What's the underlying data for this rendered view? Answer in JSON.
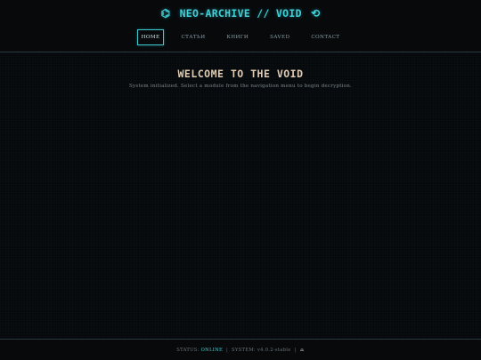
{
  "header": {
    "left_icon": "hexagon-icon",
    "left_glyph": "⌬",
    "title": "NEO-ARCHIVE // VOID",
    "right_icon": "refresh-icon",
    "right_glyph": "⟲"
  },
  "nav": {
    "items": [
      {
        "label": "HOME",
        "active": true
      },
      {
        "label": "СТАТЬИ",
        "active": false
      },
      {
        "label": "КНИГИ",
        "active": false
      },
      {
        "label": "SAVED",
        "active": false
      },
      {
        "label": "CONTACT",
        "active": false
      }
    ]
  },
  "main": {
    "title": "WELCOME TO THE VOID",
    "subtitle": "System initialized. Select a module from the navigation menu to begin decryption."
  },
  "footer": {
    "status_label": "STATUS:",
    "status_value": "ONLINE",
    "system_label": "SYSTEM:",
    "system_value": "v4.0.2-stable",
    "separator": "|",
    "end_glyph": "⏏",
    "end_icon": "eject-icon"
  },
  "colors": {
    "accent": "#3fd0d8",
    "title": "#e1ccb4",
    "background": "#06090b",
    "border": "#2a3a40"
  }
}
